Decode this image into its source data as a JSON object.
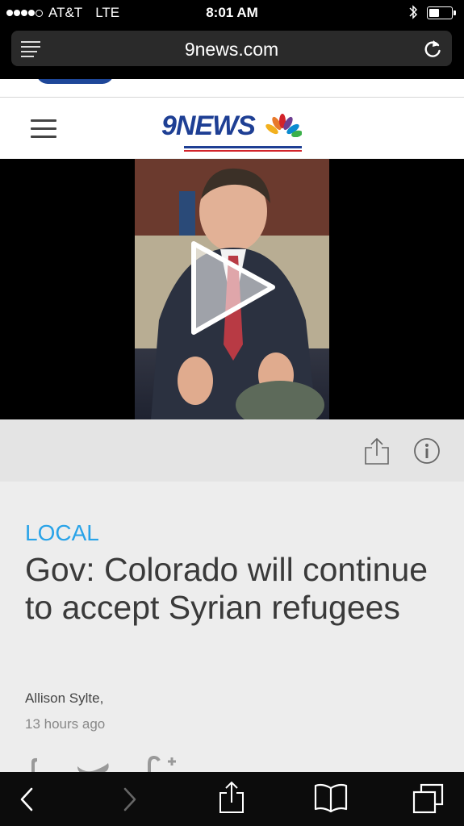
{
  "status_bar": {
    "carrier": "AT&T",
    "network": "LTE",
    "time": "8:01 AM"
  },
  "browser": {
    "domain": "9news.com"
  },
  "site": {
    "logo_text": "9NEWS"
  },
  "article": {
    "category": "LOCAL",
    "headline": "Gov: Colorado will continue to accept Syrian refugees",
    "author": "Allison Sylte,",
    "time_ago": "13 hours ago"
  },
  "colors": {
    "category_blue": "#29a3e8",
    "logo_blue": "#1e3f94",
    "logo_red": "#d2232a"
  }
}
